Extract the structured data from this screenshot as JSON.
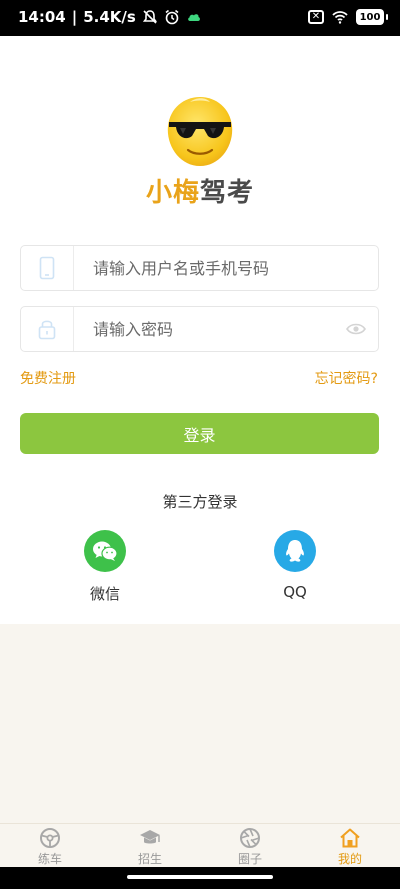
{
  "status_bar": {
    "time": "14:04",
    "net_speed": "5.4K/s",
    "battery": "100"
  },
  "logo": {
    "text_part1": "小梅",
    "text_part2": "驾考"
  },
  "login": {
    "username_placeholder": "请输入用户名或手机号码",
    "password_placeholder": "请输入密码",
    "register_label": "免费注册",
    "forgot_label": "忘记密码?",
    "login_button": "登录"
  },
  "third_party": {
    "title": "第三方登录",
    "wechat_label": "微信",
    "qq_label": "QQ"
  },
  "tabs": [
    {
      "label": "练车",
      "icon": "steering-wheel-icon",
      "active": false
    },
    {
      "label": "招生",
      "icon": "graduation-cap-icon",
      "active": false
    },
    {
      "label": "圈子",
      "icon": "camera-shutter-icon",
      "active": false
    },
    {
      "label": "我的",
      "icon": "home-icon",
      "active": true
    }
  ],
  "colors": {
    "accent": "#8cc63f",
    "link": "#e39a12",
    "wechat": "#3ec14a",
    "qq": "#27a9e6"
  }
}
